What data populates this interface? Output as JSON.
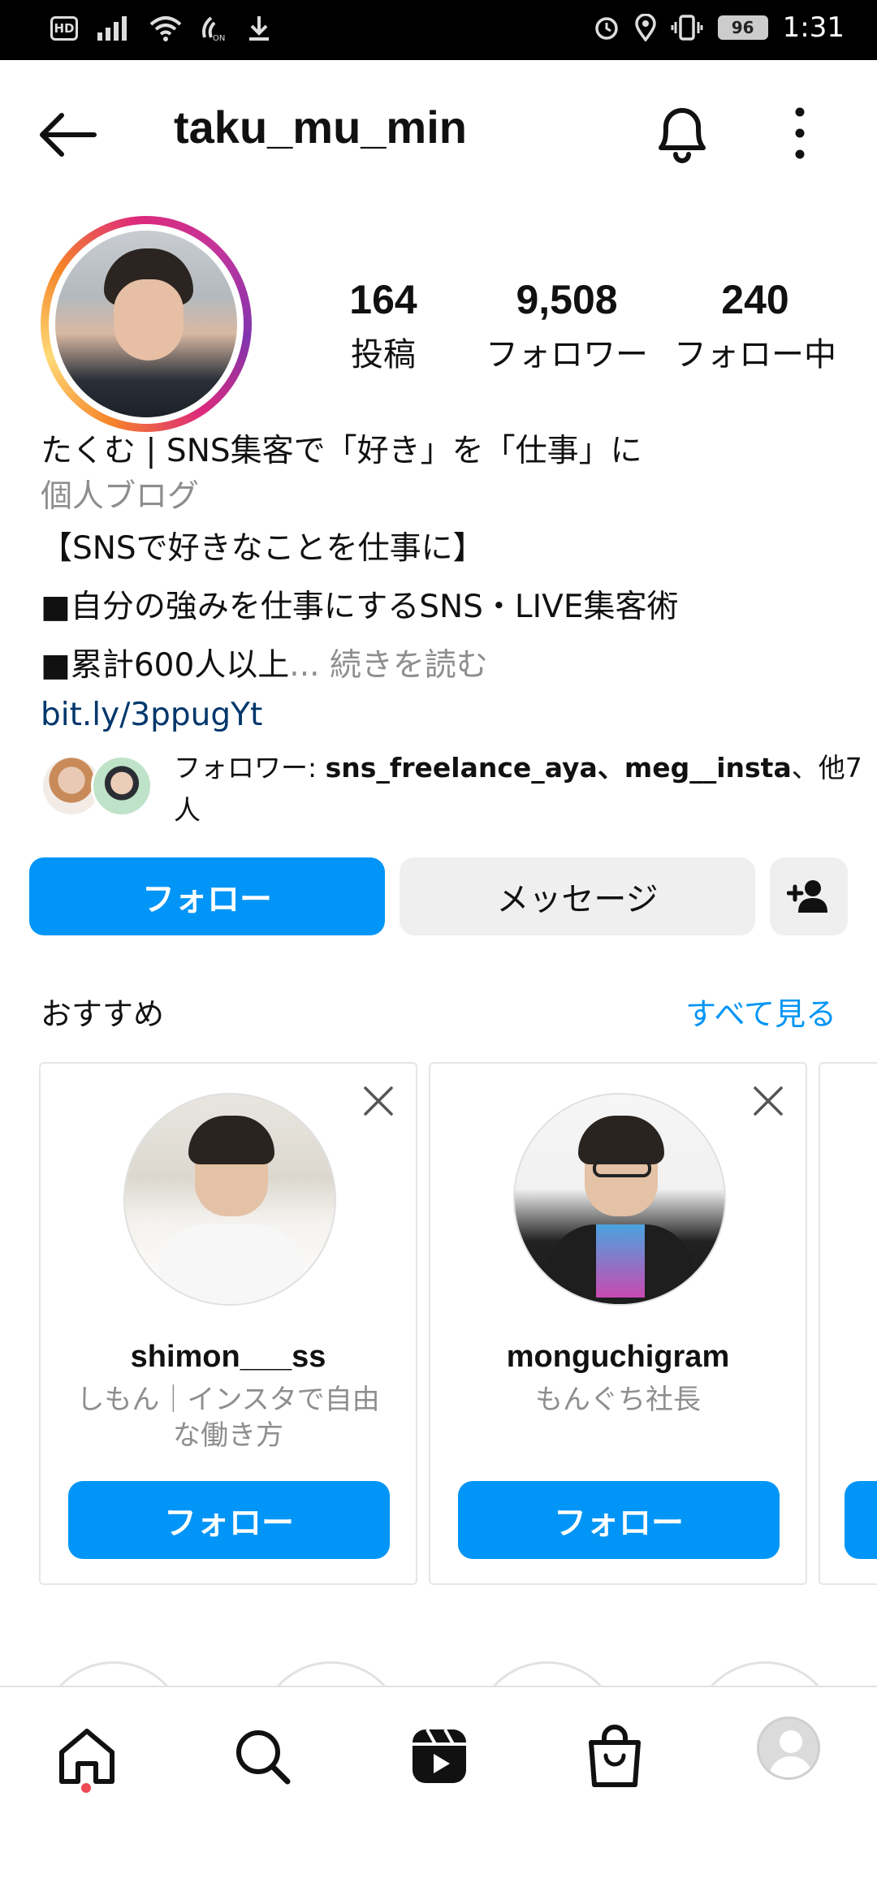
{
  "status_bar": {
    "hd": "HD",
    "battery": "96",
    "time": "1:31"
  },
  "header": {
    "username": "taku_mu_min"
  },
  "profile": {
    "stats": [
      {
        "value": "164",
        "label": "投稿"
      },
      {
        "value": "9,508",
        "label": "フォロワー"
      },
      {
        "value": "240",
        "label": "フォロー中"
      }
    ],
    "bio": {
      "name": "たくむ | SNS集客で「好き」を「仕事」に",
      "category": "個人ブログ",
      "lines": [
        "【SNSで好きなことを仕事に】",
        "■自分の強みを仕事にするSNS・LIVE集客術",
        "■累計600人以上"
      ],
      "ellipsis": "...",
      "read_more": "続きを読む",
      "link": "bit.ly/3ppugYt"
    },
    "followed_by": {
      "prefix": "フォロワー: ",
      "names": "sns_freelance_aya、meg__insta",
      "suffix": "、他7人"
    }
  },
  "actions": {
    "follow": "フォロー",
    "message": "メッセージ"
  },
  "suggestions": {
    "title": "おすすめ",
    "see_all": "すべて見る",
    "cards": [
      {
        "username": "shimon___ss",
        "subtitle": "しもん｜インスタで自由な働き方",
        "button": "フォロー"
      },
      {
        "username": "monguchigram",
        "subtitle": "もんぐち社長",
        "button": "フォロー"
      }
    ]
  },
  "icons": {
    "back": "arrow-left-icon",
    "bell": "bell-icon",
    "more": "more-vertical-icon",
    "add_person": "person-add-icon",
    "close": "close-icon",
    "home": "home-icon",
    "search": "search-icon",
    "reels": "reels-icon",
    "shop": "shopping-bag-icon"
  },
  "colors": {
    "accent": "#0095f6",
    "link": "#00376b",
    "muted": "#8e8e8e",
    "notification_dot": "#ed4956"
  }
}
